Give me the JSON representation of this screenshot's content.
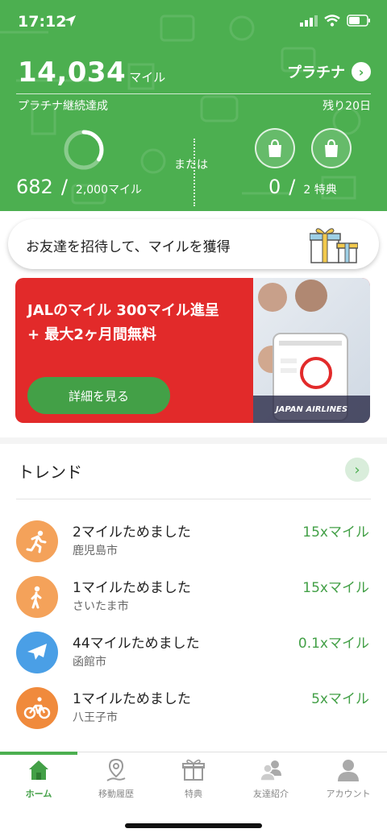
{
  "status": {
    "time": "17:12"
  },
  "header": {
    "miles_value": "14,034",
    "miles_unit": "マイル",
    "tier_label": "プラチナ",
    "streak_label": "プラチナ継続達成",
    "remaining_label": "残り20日",
    "or_label": "または",
    "progress_current": "682",
    "progress_sep": "/",
    "progress_target": "2,000マイル",
    "progress_fraction": 0.34,
    "perks_current": "0",
    "perks_sep": "/",
    "perks_target": "2 特典"
  },
  "invite": {
    "text": "お友達を招待して、マイルを獲得"
  },
  "banner": {
    "line1": "JALのマイル 300マイル進呈",
    "line2": "+ 最大2ヶ月間無料",
    "button": "詳細を見る",
    "brand": "JAPAN AIRLINES"
  },
  "trend": {
    "title": "トレンド",
    "items": [
      {
        "title": "2マイルためました",
        "city": "鹿児島市",
        "rate": "15xマイル",
        "icon": "running-icon",
        "color": "#f4a25a"
      },
      {
        "title": "1マイルためました",
        "city": "さいたま市",
        "rate": "15xマイル",
        "icon": "walking-icon",
        "color": "#f4a25a"
      },
      {
        "title": "44マイルためました",
        "city": "函館市",
        "rate": "0.1xマイル",
        "icon": "airplane-icon",
        "color": "#4a9fe6"
      },
      {
        "title": "1マイルためました",
        "city": "八王子市",
        "rate": "5xマイル",
        "icon": "bicycle-icon",
        "color": "#f08a3c"
      }
    ]
  },
  "tabs": [
    {
      "label": "ホーム",
      "icon": "home-icon",
      "active": true
    },
    {
      "label": "移動履歴",
      "icon": "map-pin-icon",
      "active": false
    },
    {
      "label": "特典",
      "icon": "gift-icon",
      "active": false
    },
    {
      "label": "友達紹介",
      "icon": "friends-icon",
      "active": false
    },
    {
      "label": "アカウント",
      "icon": "account-icon",
      "active": false
    }
  ],
  "colors": {
    "brand_green": "#4caf50",
    "banner_red": "#e22a2a"
  }
}
